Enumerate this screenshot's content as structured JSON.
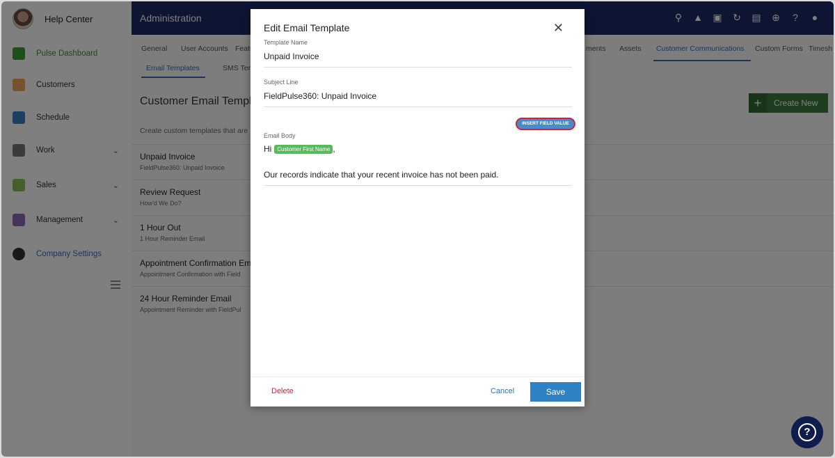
{
  "sidebar": {
    "help_center": "Help Center",
    "items": [
      {
        "label": "Pulse Dashboard"
      },
      {
        "label": "Customers"
      },
      {
        "label": "Schedule"
      },
      {
        "label": "Work"
      },
      {
        "label": "Sales"
      },
      {
        "label": "Management"
      },
      {
        "label": "Company Settings"
      }
    ]
  },
  "topbar": {
    "title": "Administration",
    "icons": [
      "search-icon",
      "bell-icon",
      "note-icon",
      "sync-icon",
      "document-icon",
      "plus-circle-icon",
      "help-icon",
      "user-menu-icon"
    ]
  },
  "tabs": {
    "items": [
      "General",
      "User Accounts",
      "Featu",
      "ments",
      "Assets",
      "Customer Communications",
      "Custom Forms",
      "Timesh"
    ],
    "active": "Customer Communications",
    "subtabs": [
      "Email Templates",
      "SMS Tem"
    ]
  },
  "section": {
    "title": "Customer Email Templat",
    "description": "Create custom templates that are",
    "create_label": "Create New"
  },
  "templates": [
    {
      "title": "Unpaid Invoice",
      "subtitle": "FieldPulse360: Unpaid Invoice"
    },
    {
      "title": "Review Request",
      "subtitle": "How'd We Do?"
    },
    {
      "title": "1 Hour Out",
      "subtitle": "1 Hour Reminder Email"
    },
    {
      "title": "Appointment Confirmation Em",
      "subtitle": "Appointment Confirmation with Field"
    },
    {
      "title": "24 Hour Reminder Email",
      "subtitle": "Appointment Reminder with FieldPul"
    }
  ],
  "modal": {
    "title": "Edit Email Template",
    "template_name_label": "Template Name",
    "template_name_value": "Unpaid Invoice",
    "subject_label": "Subject Line",
    "subject_value": "FieldPulse360: Unpaid Invoice",
    "insert_label": "INSERT FIELD VALUE",
    "body_label": "Email Body",
    "body_greeting": "Hi",
    "body_token": "Customer First Name",
    "body_comma": ",",
    "body_text": "Our records indicate that your recent invoice has not been paid.",
    "delete_label": "Delete",
    "cancel_label": "Cancel",
    "save_label": "Save"
  },
  "colors": {
    "topbar": "#1b2a66",
    "accent": "#2a73b8",
    "create": "#3d7a3d",
    "token": "#5cb85c",
    "delete": "#c4283a"
  }
}
